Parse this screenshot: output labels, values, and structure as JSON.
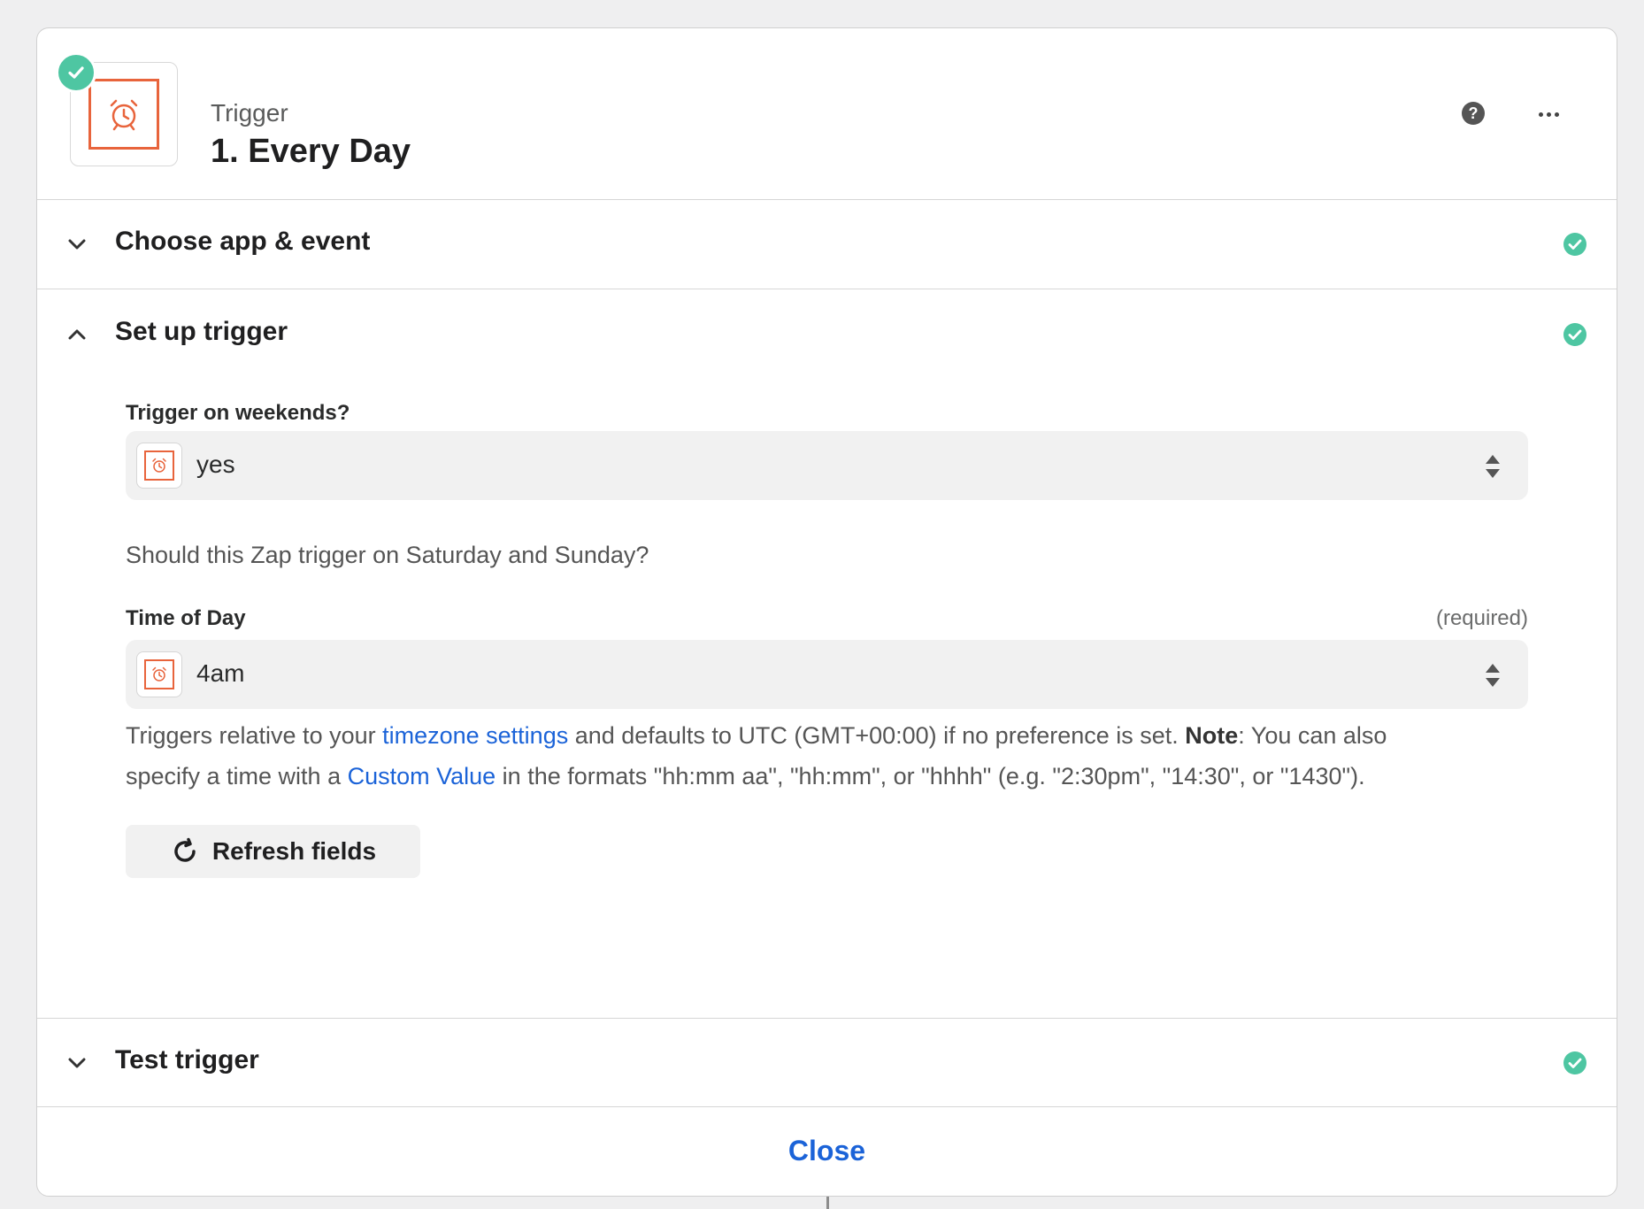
{
  "header": {
    "kicker": "Trigger",
    "title": "1. Every Day",
    "app_icon": "alarm-clock-icon",
    "status_icon": "check-circle-icon",
    "help_icon": "question-circle-icon",
    "more_icon": "ellipsis-icon"
  },
  "sections": {
    "choose": {
      "title": "Choose app & event",
      "expanded": false,
      "complete": true
    },
    "setup": {
      "title": "Set up trigger",
      "expanded": true,
      "complete": true
    },
    "test": {
      "title": "Test trigger",
      "expanded": false,
      "complete": true
    }
  },
  "fields": {
    "weekends": {
      "label": "Trigger on weekends?",
      "value": "yes",
      "help": "Should this Zap trigger on Saturday and Sunday?"
    },
    "time": {
      "label": "Time of Day",
      "required": "(required)",
      "value": "4am",
      "help_part1": "Triggers relative to your ",
      "help_link1": "timezone settings",
      "help_part2": " and defaults to UTC (GMT+00:00) if no preference is set. ",
      "help_note": "Note",
      "help_part3": ": You can also",
      "help_part4": "specify a time with a ",
      "help_link2": "Custom Value",
      "help_part5": " in the formats \"hh:mm aa\", \"hh:mm\", or \"hhhh\" (e.g. \"2:30pm\", \"14:30\", or \"1430\")."
    }
  },
  "refresh": {
    "label": "Refresh fields"
  },
  "footer": {
    "close_label": "Close"
  },
  "colors": {
    "accent": "#1b63d8",
    "success": "#4ec6a2",
    "app_brand": "#e8643c"
  }
}
